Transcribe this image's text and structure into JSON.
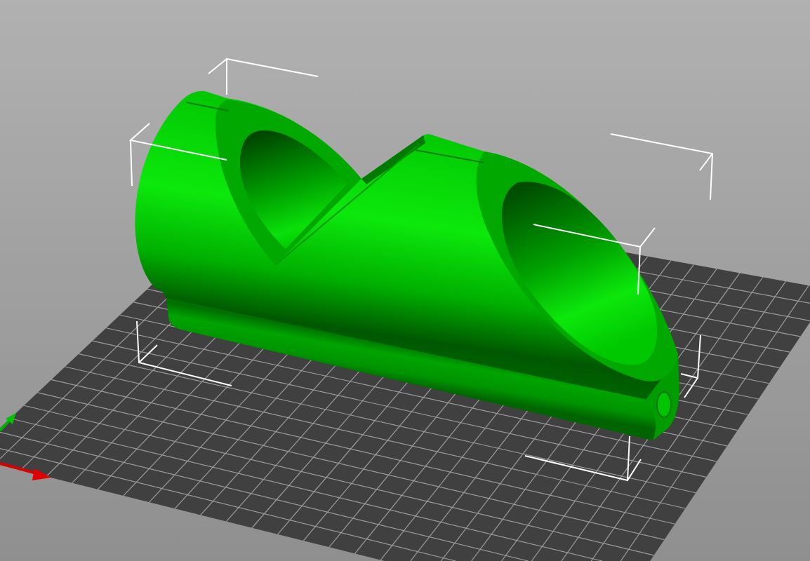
{
  "scene": {
    "objects": [
      {
        "selected": true
      }
    ]
  }
}
